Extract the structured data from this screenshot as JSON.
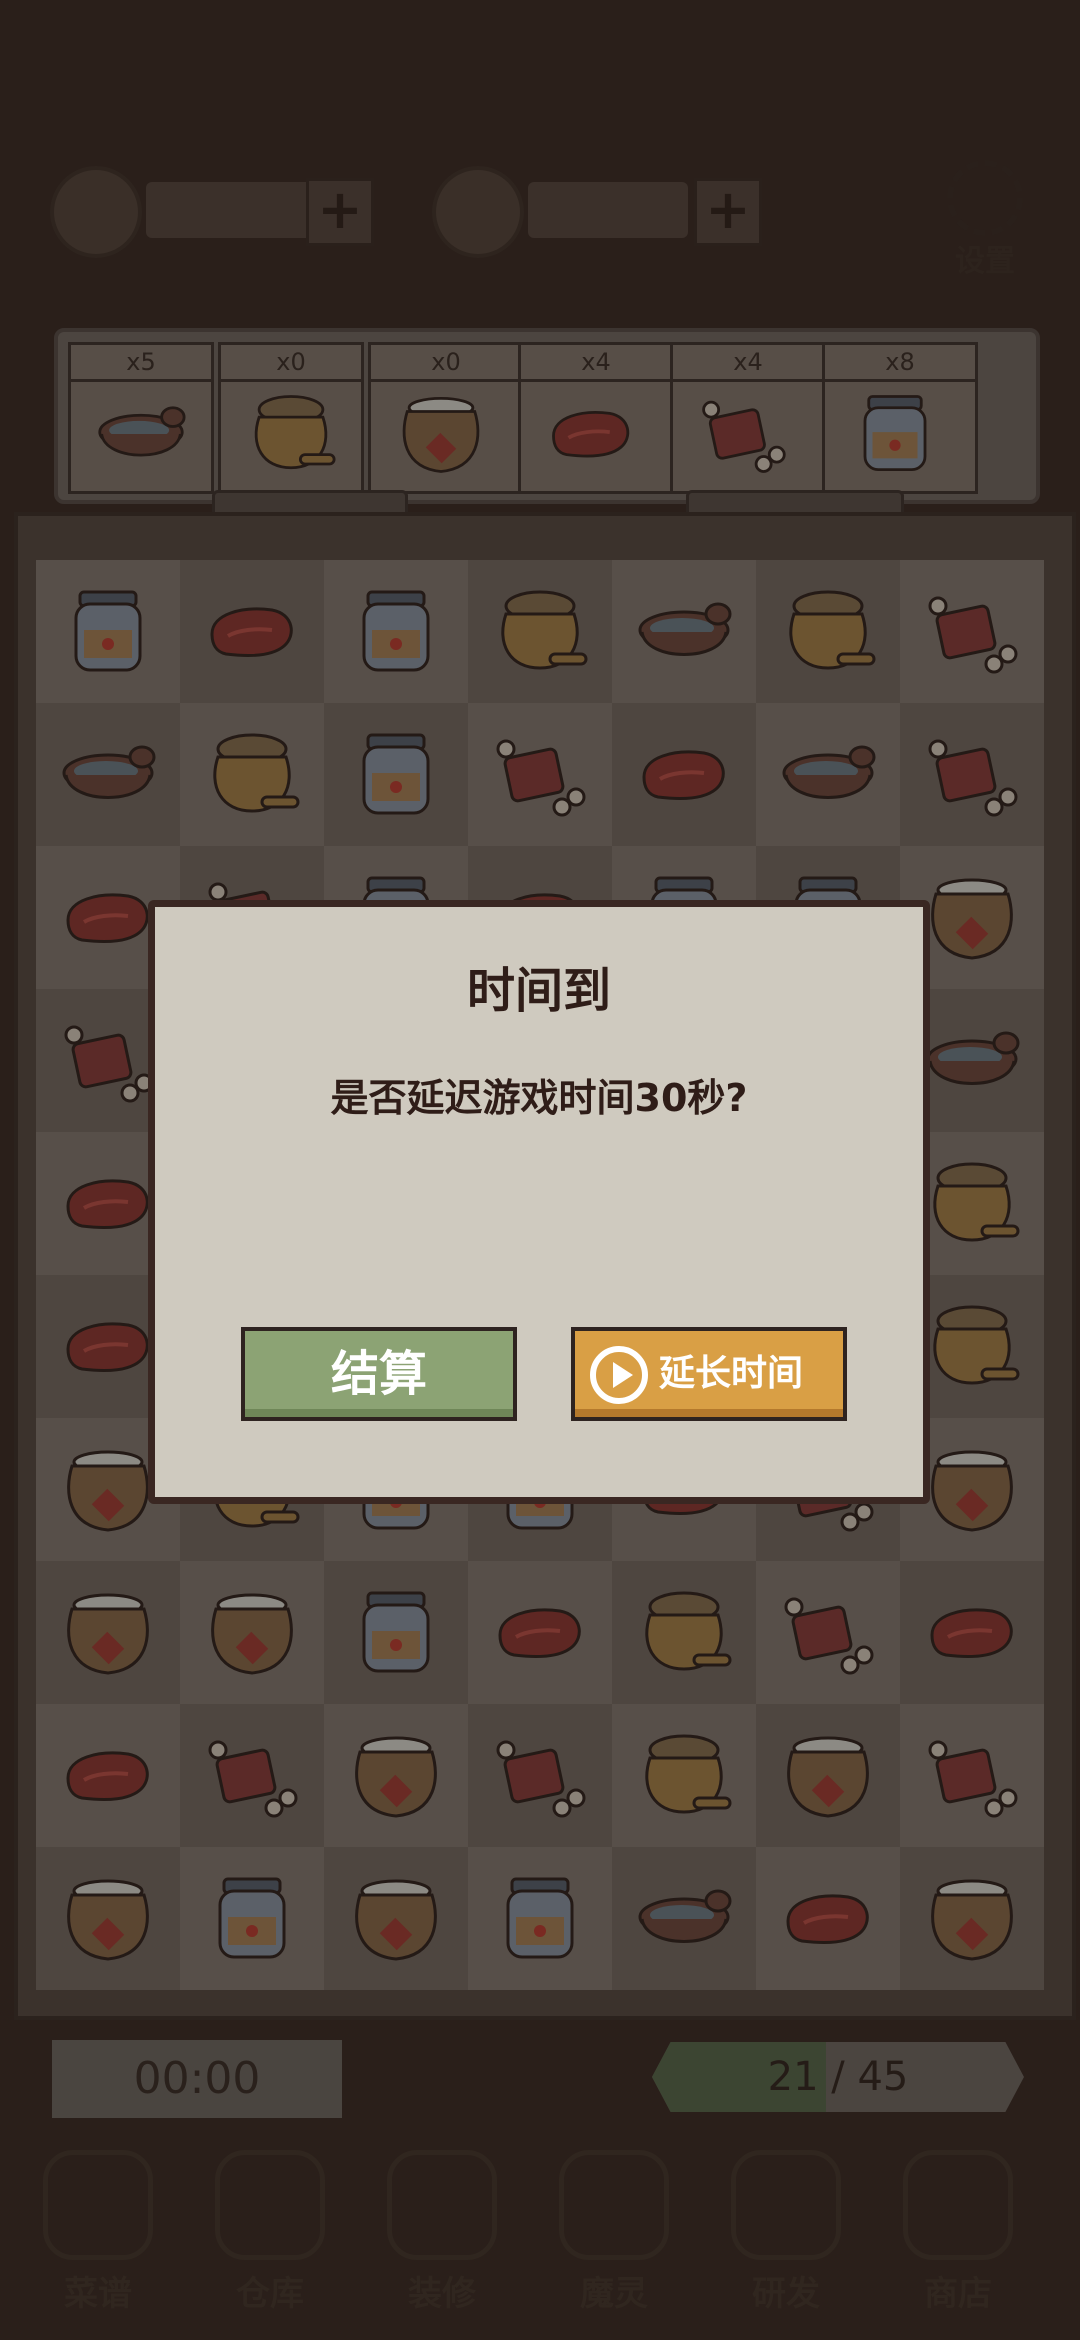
{
  "colors": {
    "dialog_bg": "#cfcabf",
    "settle_button": "#8ca374",
    "extend_button": "#d99f45",
    "dim_overlay": "#2a1f1a"
  },
  "top_bar": {
    "settings_label": "设置"
  },
  "goals": [
    {
      "count": "x5",
      "item": "bowl"
    },
    {
      "count": "x0",
      "item": "honey-pot"
    },
    {
      "count": "x0",
      "item": "rice-sack"
    },
    {
      "count": "x4",
      "item": "steak"
    },
    {
      "count": "x4",
      "item": "meat-ribs"
    },
    {
      "count": "x8",
      "item": "jar"
    }
  ],
  "board": {
    "rows": [
      [
        "jar",
        "steak",
        "jar",
        "honey-pot",
        "bowl",
        "honey-pot",
        "meat-ribs"
      ],
      [
        "bowl",
        "honey-pot",
        "jar",
        "meat-ribs",
        "steak",
        "bowl",
        "meat-ribs"
      ],
      [
        "steak",
        "meat-ribs",
        "jar",
        "steak",
        "jar",
        "jar",
        "rice-sack"
      ],
      [
        "meat-ribs",
        "steak",
        "bowl",
        "honey-pot",
        "steak",
        "jar",
        "bowl"
      ],
      [
        "steak",
        "honey-pot",
        "rice-sack",
        "steak",
        "meat-ribs",
        "bowl",
        "honey-pot"
      ],
      [
        "steak",
        "bowl",
        "steak",
        "honey-pot",
        "jar",
        "rice-sack",
        "honey-pot"
      ],
      [
        "rice-sack",
        "honey-pot",
        "jar",
        "jar",
        "steak",
        "meat-ribs",
        "rice-sack"
      ],
      [
        "rice-sack",
        "rice-sack",
        "jar",
        "steak",
        "honey-pot",
        "meat-ribs",
        "steak"
      ],
      [
        "steak",
        "meat-ribs",
        "rice-sack",
        "meat-ribs",
        "honey-pot",
        "rice-sack",
        "meat-ribs"
      ],
      [
        "rice-sack",
        "jar",
        "rice-sack",
        "jar",
        "bowl",
        "steak",
        "rice-sack"
      ]
    ]
  },
  "timer": "00:00",
  "progress": {
    "current": "21",
    "total": "45",
    "separator": " / "
  },
  "nav": {
    "items": [
      "菜谱",
      "仓库",
      "装修",
      "魔灵",
      "研发",
      "商店"
    ]
  },
  "dialog": {
    "title": "时间到",
    "message": "是否延迟游戏时间30秒?",
    "settle_label": "结算",
    "extend_label": "延长时间"
  }
}
